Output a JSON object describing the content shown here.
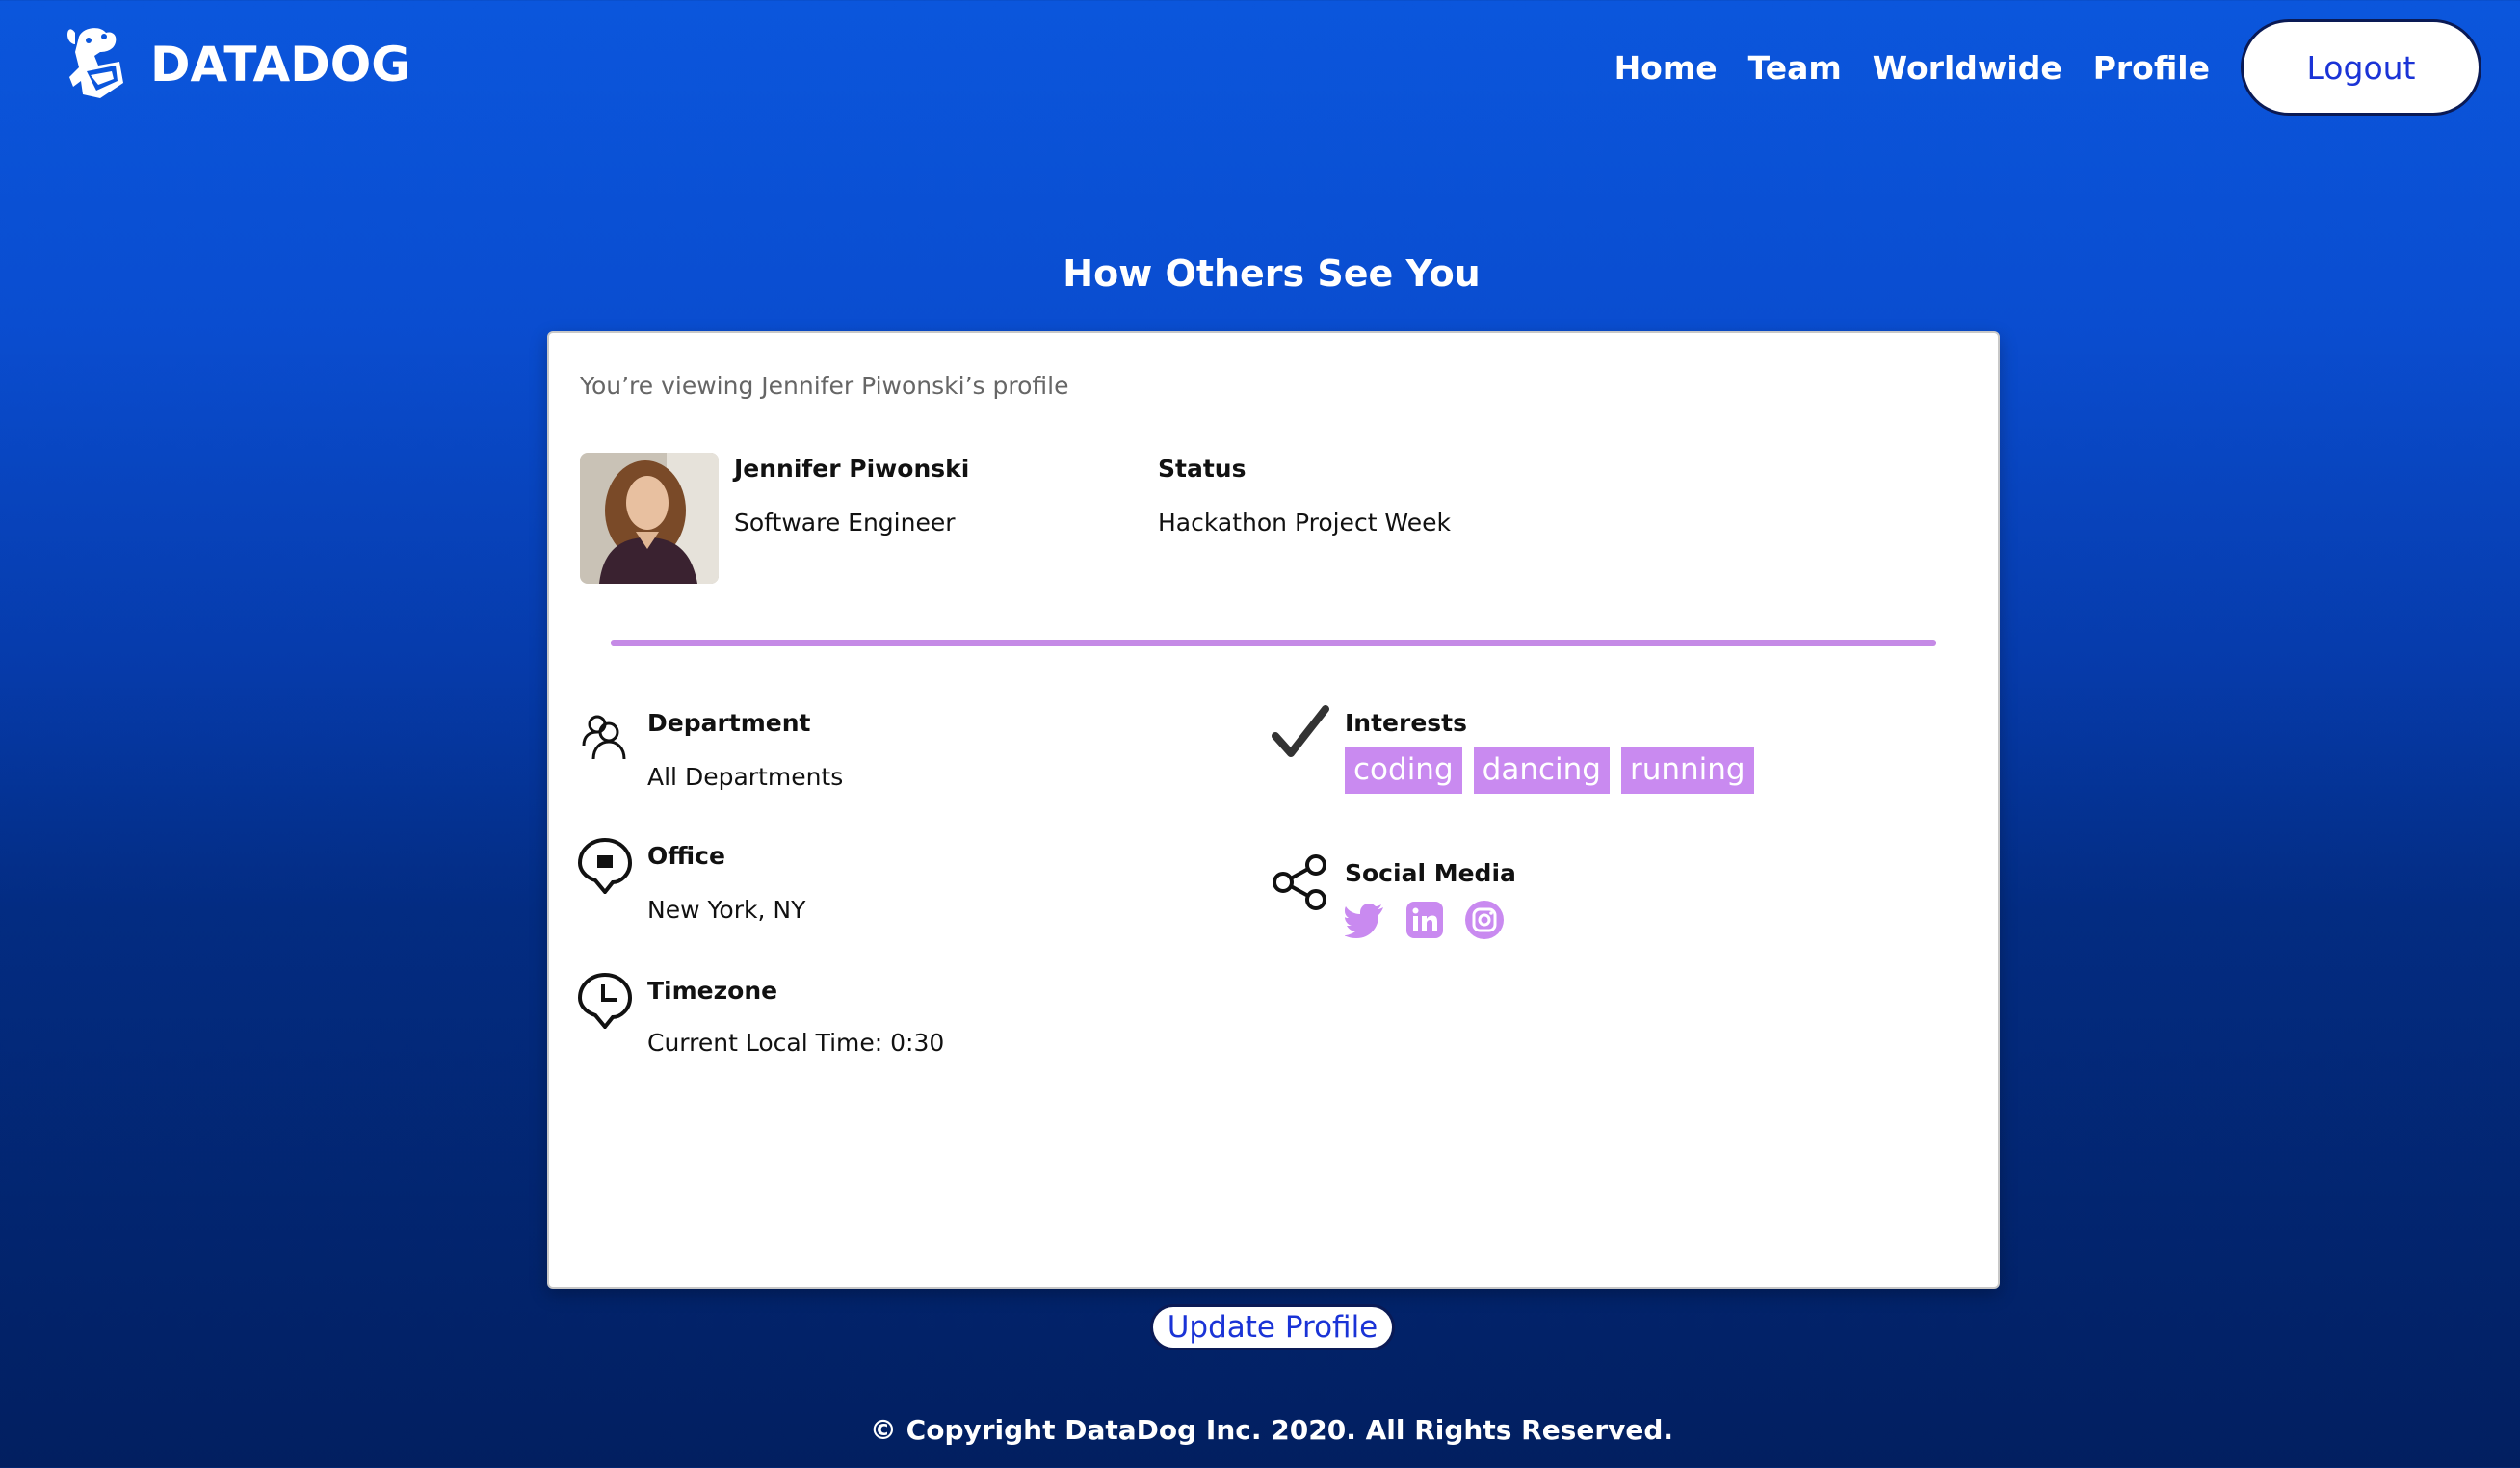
{
  "header": {
    "logo_text": "DATADOG",
    "nav": [
      {
        "label": "Home"
      },
      {
        "label": "Team"
      },
      {
        "label": "Worldwide"
      },
      {
        "label": "Profile"
      }
    ],
    "logout_label": "Logout"
  },
  "page_title": "How Others See You",
  "profile": {
    "viewing_note": "You’re viewing Jennifer Piwonski’s profile",
    "name": "Jennifer Piwonski",
    "job_title": "Software Engineer",
    "status_label": "Status",
    "status_value": "Hackathon Project Week",
    "department_label": "Department",
    "department_value": "All Departments",
    "office_label": "Office",
    "office_value": "New York, NY",
    "timezone_label": "Timezone",
    "timezone_value": "Current Local Time: 0:30",
    "interests_label": "Interests",
    "interests": [
      "coding",
      "dancing",
      "running"
    ],
    "social_label": "Social Media",
    "socials": [
      {
        "icon": "twitter-icon"
      },
      {
        "icon": "linkedin-icon"
      },
      {
        "icon": "instagram-icon"
      }
    ]
  },
  "update_label": "Update Profile",
  "footer": "© Copyright DataDog Inc. 2020. All Rights Reserved.",
  "colors": {
    "accent": "#c98af0",
    "button_text": "#1a33d6",
    "bg_top": "#0b56dc",
    "bg_bottom": "#021f60"
  }
}
